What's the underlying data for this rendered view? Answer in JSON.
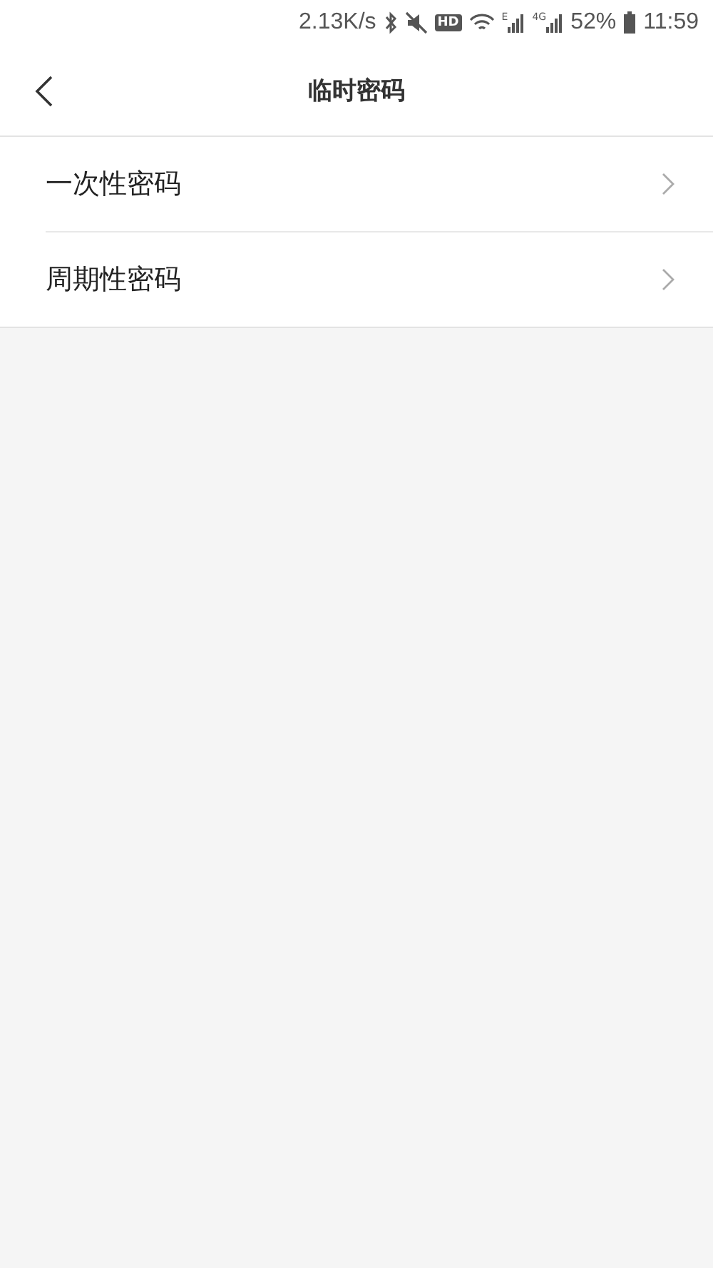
{
  "status_bar": {
    "speed": "2.13K/s",
    "hd_badge": "HD",
    "networks": [
      "E",
      "4G"
    ],
    "battery": "52%",
    "time": "11:59"
  },
  "header": {
    "title": "临时密码"
  },
  "items": [
    {
      "label": "一次性密码"
    },
    {
      "label": "周期性密码"
    }
  ]
}
